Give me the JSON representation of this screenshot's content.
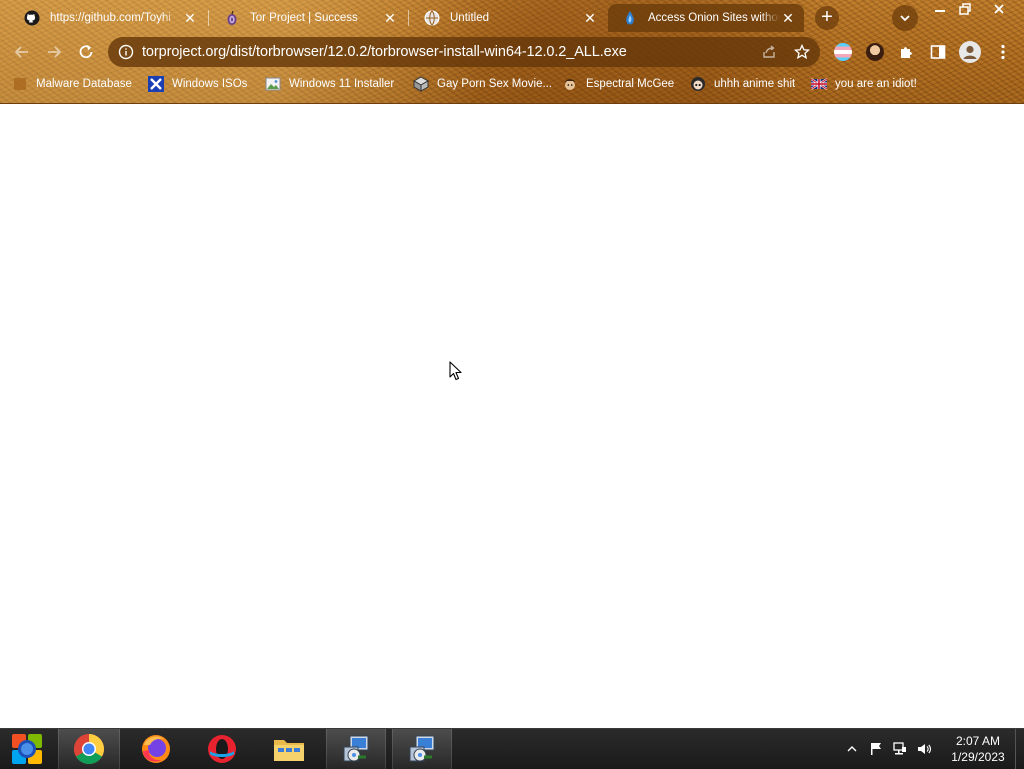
{
  "browser": {
    "tabs": [
      {
        "title": "https://github.com/Toyhi",
        "icon": "github-icon"
      },
      {
        "title": "Tor Project | Success",
        "icon": "tor-onion-icon"
      },
      {
        "title": "Untitled",
        "icon": "globe-icon"
      },
      {
        "title": "Access Onion Sites withou",
        "icon": "onion-access-icon",
        "active": true
      }
    ],
    "new_tab_label": "+",
    "url": "torproject.org/dist/torbrowser/12.0.2/torbrowser-install-win64-12.0.2_ALL.exe",
    "bookmarks": [
      {
        "label": "Malware Database",
        "icon": "bookmark-icon"
      },
      {
        "label": "Windows ISOs",
        "icon": "x-logo-icon"
      },
      {
        "label": "Windows 11 Installer",
        "icon": "image-icon"
      },
      {
        "label": "Gay Porn Sex Movie...",
        "icon": "site-icon"
      },
      {
        "label": "Espectral McGee",
        "icon": "character-icon"
      },
      {
        "label": "uhhh anime shit",
        "icon": "anime-icon"
      },
      {
        "label": "you are an idiot!",
        "icon": "flag-icon"
      }
    ]
  },
  "taskbar": {
    "clock_time": "2:07 AM",
    "clock_date": "1/29/2023"
  },
  "colors": {
    "theme_brown": "#a9681e",
    "taskbar": "#1f1f1f"
  }
}
